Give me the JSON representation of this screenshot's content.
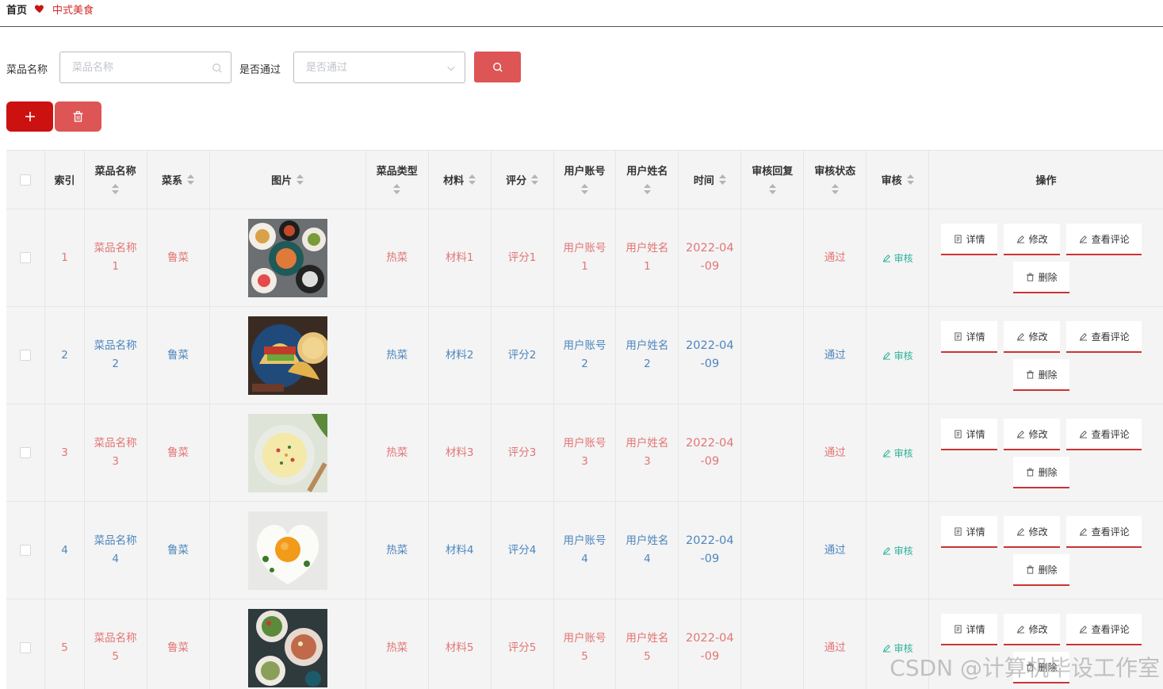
{
  "breadcrumb": {
    "home": "首页",
    "current": "中式美食"
  },
  "search": {
    "name_label": "菜品名称",
    "name_placeholder": "菜品名称",
    "pass_label": "是否通过",
    "pass_placeholder": "是否通过"
  },
  "table": {
    "headers": {
      "index": "索引",
      "name": "菜品名称",
      "cuisine": "菜系",
      "image": "图片",
      "type": "菜品类型",
      "material": "材料",
      "score": "评分",
      "account": "用户账号",
      "username": "用户姓名",
      "time": "时间",
      "reply": "审核回复",
      "status": "审核状态",
      "audit": "审核",
      "ops": "操作"
    },
    "rows": [
      {
        "index": "1",
        "name1": "菜品名称",
        "name2": "1",
        "cuisine": "鲁菜",
        "type": "热菜",
        "material": "材料1",
        "score": "评分1",
        "acc1": "用户账号",
        "acc2": "1",
        "user1": "用户姓名",
        "user2": "1",
        "time1": "2022-04",
        "time2": "-09",
        "reply": "",
        "status": "通过",
        "audit": "审核",
        "image": "dishes-plates-icon",
        "color": "red"
      },
      {
        "index": "2",
        "name1": "菜品名称",
        "name2": "2",
        "cuisine": "鲁菜",
        "type": "热菜",
        "material": "材料2",
        "score": "评分2",
        "acc1": "用户账号",
        "acc2": "2",
        "user1": "用户姓名",
        "user2": "2",
        "time1": "2022-04",
        "time2": "-09",
        "reply": "",
        "status": "通过",
        "audit": "审核",
        "image": "tacos-icon",
        "color": "blue"
      },
      {
        "index": "3",
        "name1": "菜品名称",
        "name2": "3",
        "cuisine": "鲁菜",
        "type": "热菜",
        "material": "材料3",
        "score": "评分3",
        "acc1": "用户账号",
        "acc2": "3",
        "user1": "用户姓名",
        "user2": "3",
        "time1": "2022-04",
        "time2": "-09",
        "reply": "",
        "status": "通过",
        "audit": "审核",
        "image": "soup-bowl-icon",
        "color": "red"
      },
      {
        "index": "4",
        "name1": "菜品名称",
        "name2": "4",
        "cuisine": "鲁菜",
        "type": "热菜",
        "material": "材料4",
        "score": "评分4",
        "acc1": "用户账号",
        "acc2": "4",
        "user1": "用户姓名",
        "user2": "4",
        "time1": "2022-04",
        "time2": "-09",
        "reply": "",
        "status": "通过",
        "audit": "审核",
        "image": "heart-egg-icon",
        "color": "blue"
      },
      {
        "index": "5",
        "name1": "菜品名称",
        "name2": "5",
        "cuisine": "鲁菜",
        "type": "热菜",
        "material": "材料5",
        "score": "评分5",
        "acc1": "用户账号",
        "acc2": "5",
        "user1": "用户姓名",
        "user2": "5",
        "time1": "2022-04",
        "time2": "-09",
        "reply": "",
        "status": "通过",
        "audit": "审核",
        "image": "salad-plates-icon",
        "color": "red"
      }
    ],
    "actions": {
      "detail": "详情",
      "edit": "修改",
      "comments": "查看评论",
      "delete": "删除"
    }
  },
  "watermark": "CSDN @计算机毕设工作室",
  "colors": {
    "accent": "#dd5555",
    "primary": "#cc1111",
    "red_text": "#e27575",
    "blue_text": "#4d86bd",
    "green_text": "#2bb39a"
  }
}
